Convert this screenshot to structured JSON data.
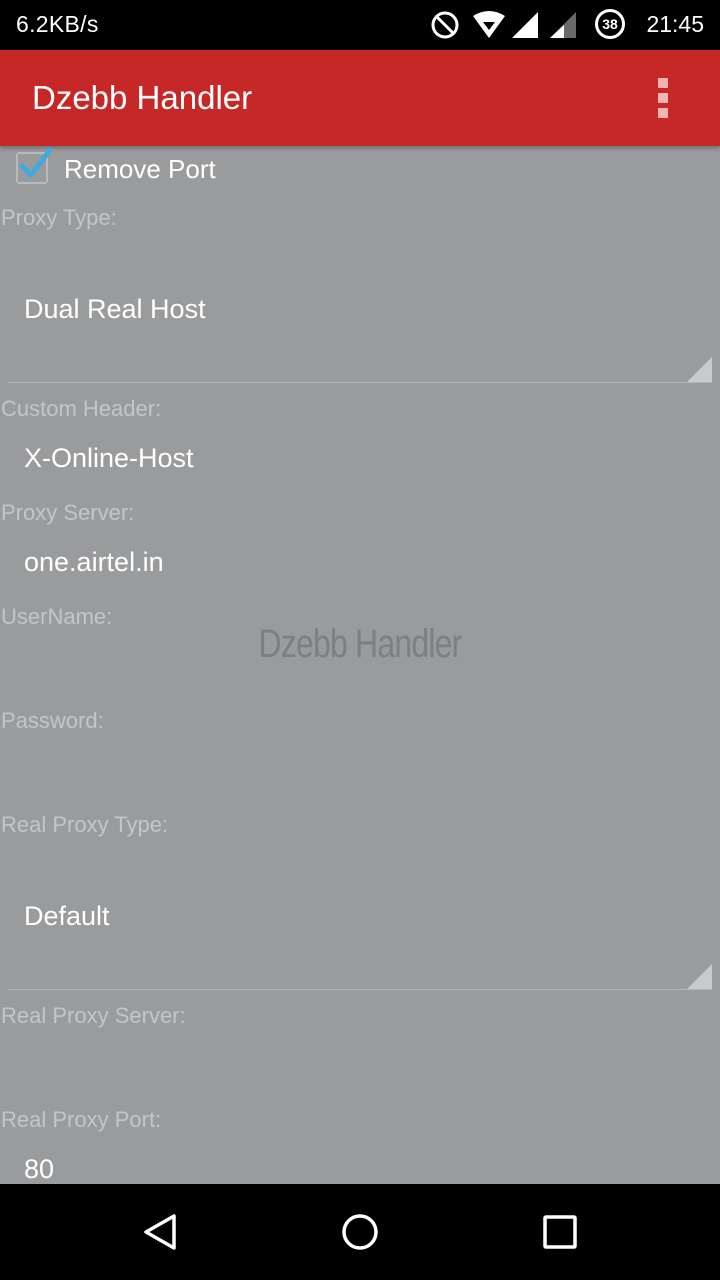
{
  "status_bar": {
    "net_speed": "6.2KB/s",
    "battery_level": "38",
    "time": "21:45"
  },
  "app_bar": {
    "title": "Dzebb Handler",
    "overflow_icon": "more-vert-icon"
  },
  "form": {
    "remove_port": {
      "label": "Remove Port",
      "checked": true
    },
    "proxy_type": {
      "label": "Proxy Type:",
      "value": "Dual Real Host"
    },
    "custom_header": {
      "label": "Custom Header:",
      "value": "X-Online-Host"
    },
    "proxy_server": {
      "label": "Proxy Server:",
      "value": "one.airtel.in"
    },
    "username": {
      "label": "UserName:",
      "value": ""
    },
    "password": {
      "label": "Password:",
      "value": ""
    },
    "real_proxy_type": {
      "label": "Real Proxy Type:",
      "value": "Default"
    },
    "real_proxy_server": {
      "label": "Real Proxy Server:",
      "value": ""
    },
    "real_proxy_port": {
      "label": "Real Proxy Port:",
      "value": "80"
    }
  },
  "watermark": "Dzebb Handler",
  "nav_bar": {
    "back_icon": "back-triangle-icon",
    "home_icon": "home-circle-icon",
    "recents_icon": "recents-square-icon"
  },
  "colors": {
    "app_bar": "#c62828",
    "background": "#9a9b9d",
    "checkmark": "#3fa9e0"
  }
}
